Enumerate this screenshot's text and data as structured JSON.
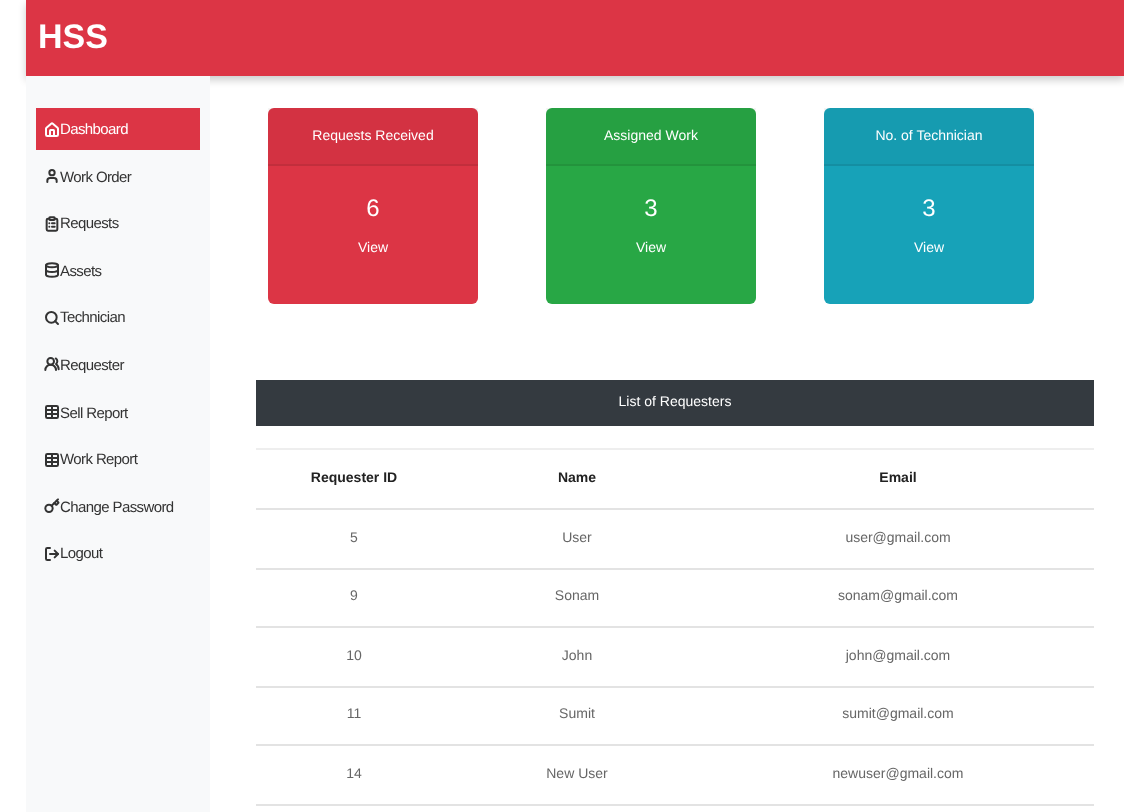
{
  "header": {
    "title": "HSS"
  },
  "sidebar": {
    "items": [
      {
        "label": "Dashboard",
        "selected": true
      },
      {
        "label": "Work Order",
        "selected": false
      },
      {
        "label": "Requests",
        "selected": false
      },
      {
        "label": "Assets",
        "selected": false
      },
      {
        "label": "Technician",
        "selected": false
      },
      {
        "label": "Requester",
        "selected": false
      },
      {
        "label": "Sell Report",
        "selected": false
      },
      {
        "label": "Work Report",
        "selected": false
      },
      {
        "label": "Change Password",
        "selected": false
      },
      {
        "label": "Logout",
        "selected": false
      }
    ]
  },
  "cards": [
    {
      "title": "Requests Received",
      "count": "6",
      "link": "View",
      "color": "#dc3545"
    },
    {
      "title": "Assigned Work",
      "count": "3",
      "link": "View",
      "color": "#28a745"
    },
    {
      "title": "No. of Technician",
      "count": "3",
      "link": "View",
      "color": "#17a2b8"
    }
  ],
  "table": {
    "title": "List of Requesters",
    "columns": [
      "Requester ID",
      "Name",
      "Email"
    ],
    "rows": [
      [
        "5",
        "User",
        "user@gmail.com"
      ],
      [
        "9",
        "Sonam",
        "sonam@gmail.com"
      ],
      [
        "10",
        "John",
        "john@gmail.com"
      ],
      [
        "11",
        "Sumit",
        "sumit@gmail.com"
      ],
      [
        "14",
        "New User",
        "newuser@gmail.com"
      ]
    ]
  }
}
